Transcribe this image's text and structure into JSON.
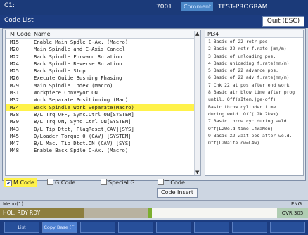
{
  "topbar": {
    "left_label": "C1:",
    "program_number": "7001",
    "mode_label": "Comment",
    "program_name": "TEST-PROGRAM"
  },
  "window": {
    "title": "Code List",
    "quit_label": "Quit (ESC)"
  },
  "list": {
    "columns": {
      "code": "M Code",
      "name": "Name"
    },
    "rows": [
      {
        "code": "M15",
        "name": "Enable Main Spdle C-Ax. (Macro)"
      },
      {
        "code": "M20",
        "name": "Main Spindle and C-Axis Cancel"
      },
      {
        "code": "M22",
        "name": "Back Spindle Forward Rotation"
      },
      {
        "code": "M24",
        "name": "Back Spindle Reverse Rotation"
      },
      {
        "code": "M25",
        "name": "Back Spindle Stop"
      },
      {
        "code": "M26",
        "name": "Execute Guide Bushing Phasing"
      },
      {
        "code": "M29",
        "name": "Main Spindle Index (Macro)"
      },
      {
        "code": "M31",
        "name": "Workpiece Conveyor ON"
      },
      {
        "code": "M32",
        "name": "Work Separate Positioning (Mac)"
      },
      {
        "code": "M34",
        "name": "Back Spindle Work Separate(Macro)"
      },
      {
        "code": "M38",
        "name": "B/L Trq OFF, Sync.Ctrl ON[SYSTEM]"
      },
      {
        "code": "M39",
        "name": "B/L Trq ON, Sync.Ctrl ON[SYSTEM]"
      },
      {
        "code": "M43",
        "name": "B/L Tip Dtct, FlagReset[CAV][SYS]"
      },
      {
        "code": "M45",
        "name": "D/Loader Torque 0 (CAV) [SYSTEM]"
      },
      {
        "code": "M47",
        "name": "B/L Mac. Tip Dtct.ON (CAV) [SYS]"
      },
      {
        "code": "M48",
        "name": "Enable Back Spdle C-Ax. (Macro)"
      }
    ],
    "selected_index": 9
  },
  "description": {
    "header": "M34",
    "lines": [
      "1 Basic of 22 retr pos.",
      "2 Basic 22 retr f.rate (mm/m)",
      "3 Basic of unloading pos.",
      "4 Basic unloading f.rate(mm/m)",
      "5 Basic of 22 advance pos.",
      "6 Basic of 22 adv f.rate(mm/m)",
      "7 Chk 22 at pos after end work",
      "8 Basic air blow time after prog",
      "  until. Off(sItem.jge-off)",
      "  Basic throw cylinder time",
      "  during weld. Off(L2k.2kwk)",
      "7 Basic throw cyc during weld.",
      "  Off(L2Weld-time L4WaNen)",
      "9 Basic X2 wait pos after weld.",
      "  Off(L2Waite cw=L4w)"
    ]
  },
  "filters": [
    {
      "label": "M Code",
      "checked": true
    },
    {
      "label": "G Code",
      "checked": false
    },
    {
      "label": "Special G",
      "checked": false
    },
    {
      "label": "T Code",
      "checked": false
    }
  ],
  "code_insert_label": "Code Insert",
  "menu_line": {
    "left": "Menu(1)",
    "right": "ENG"
  },
  "status": {
    "left": "HOL. RDY RDY",
    "right": "OVR 305"
  },
  "softkeys": [
    {
      "label": "List",
      "active": false
    },
    {
      "label": "Copy Base (F)",
      "active": true
    },
    {
      "label": "",
      "active": false
    },
    {
      "label": "",
      "active": false
    },
    {
      "label": "",
      "active": false
    },
    {
      "label": "",
      "active": false
    },
    {
      "label": "",
      "active": false
    },
    {
      "label": "",
      "active": false
    }
  ],
  "colors": {
    "header_blue": "#1c3c80",
    "selected_row": "#fff24a",
    "status_green": "#7cae2e"
  }
}
